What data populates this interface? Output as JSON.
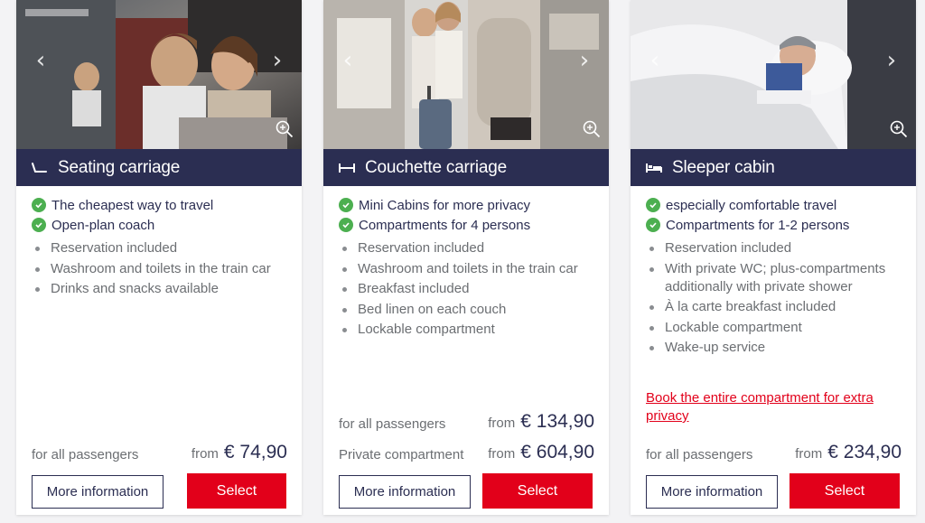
{
  "colors": {
    "header_bg": "#2b2e52",
    "accent_red": "#e2001a",
    "check_green": "#4caf50",
    "text_navy": "#2b2e52",
    "text_grey": "#6b6e72"
  },
  "cards": [
    {
      "title": "Seating carriage",
      "icon": "seat-icon",
      "highlights": [
        "The cheapest way to travel",
        "Open-plan coach"
      ],
      "features": [
        "Reservation included",
        "Washroom and toilets in the train car",
        "Drinks and snacks available"
      ],
      "prices": [
        {
          "label": "for all passengers",
          "from": "from",
          "amount": "€ 74,90"
        }
      ],
      "more_label": "More information",
      "select_label": "Select"
    },
    {
      "title": "Couchette carriage",
      "icon": "couchette-icon",
      "highlights": [
        "Mini Cabins for more privacy",
        "Compartments for 4 persons"
      ],
      "features": [
        "Reservation included",
        "Washroom and toilets in the train car",
        "Breakfast included",
        "Bed linen on each couch",
        "Lockable compartment"
      ],
      "prices": [
        {
          "label": "for all passengers",
          "from": "from",
          "amount": "€ 134,90"
        },
        {
          "label": "Private compartment",
          "from": "from",
          "amount": "€ 604,90"
        }
      ],
      "more_label": "More information",
      "select_label": "Select"
    },
    {
      "title": "Sleeper cabin",
      "icon": "bed-icon",
      "highlights": [
        "especially comfortable travel",
        "Compartments for 1-2 persons"
      ],
      "features": [
        "Reservation included",
        "With private WC; plus-compartments additionally with private shower",
        "À la carte breakfast included",
        "Lockable compartment",
        "Wake-up service"
      ],
      "extra_link": "Book the entire compartment for extra privacy",
      "prices": [
        {
          "label": "for all passengers",
          "from": "from",
          "amount": "€ 234,90"
        }
      ],
      "more_label": "More information",
      "select_label": "Select"
    }
  ],
  "gallery": {
    "prev_glyph": "‹",
    "next_glyph": "›"
  }
}
